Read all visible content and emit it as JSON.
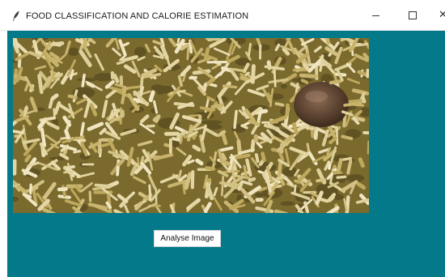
{
  "window": {
    "title": "FOOD CLASSIFICATION AND CALORIE ESTIMATION",
    "app_icon": "feather-icon",
    "controls": {
      "minimize": "minimize-icon",
      "maximize": "maximize-icon",
      "close_glyph": "✕"
    }
  },
  "main": {
    "background_color": "#03798a",
    "image_content": "rice-dish-photo",
    "analyse_button_label": "Analyse Image"
  }
}
